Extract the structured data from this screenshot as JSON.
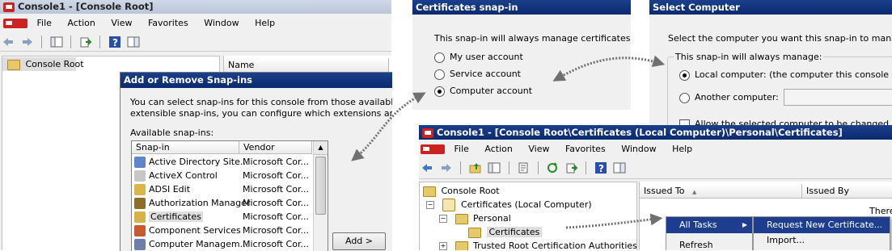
{
  "console1": {
    "title": "Console1 - [Console Root]",
    "menu": [
      "File",
      "Action",
      "View",
      "Favorites",
      "Window",
      "Help"
    ],
    "tree_root": "Console Root",
    "col_name": "Name"
  },
  "add_remove": {
    "title": "Add or Remove Snap-ins",
    "desc_line1": "You can select snap-ins for this console from those available on you",
    "desc_line2": "extensible snap-ins, you can configure which extensions are enable",
    "available_label": "Available snap-ins:",
    "col_snapin": "Snap-in",
    "col_vendor": "Vendor",
    "snapins": [
      {
        "name": "Active Directory Site...",
        "vendor": "Microsoft Cor...",
        "icon": "ad-sites-icon"
      },
      {
        "name": "ActiveX Control",
        "vendor": "Microsoft Cor...",
        "icon": "activex-icon"
      },
      {
        "name": "ADSI Edit",
        "vendor": "Microsoft Cor...",
        "icon": "adsi-edit-icon"
      },
      {
        "name": "Authorization Manager",
        "vendor": "Microsoft Cor...",
        "icon": "authorization-icon"
      },
      {
        "name": "Certificates",
        "vendor": "Microsoft Cor...",
        "icon": "certificates-icon"
      },
      {
        "name": "Component Services",
        "vendor": "Microsoft Cor...",
        "icon": "component-services-icon"
      },
      {
        "name": "Computer Managem...",
        "vendor": "Microsoft Cor...",
        "icon": "computer-management-icon"
      }
    ],
    "add_button": "Add >"
  },
  "cert_snapin": {
    "title": "Certificates snap-in",
    "prompt": "This snap-in will always manage certificates for:",
    "options": [
      "My user account",
      "Service account",
      "Computer account"
    ],
    "selected": 2
  },
  "select_computer": {
    "title": "Select Computer",
    "prompt": "Select the computer you want this snap-in to manage.",
    "group_label": "This snap-in will always manage:",
    "local_option": "Local computer:  (the computer this console is runnin",
    "another_option": "Another computer:",
    "allow_text": "Allow the selected computer to be changed when la"
  },
  "console2": {
    "title": "Console1 - [Console Root\\Certificates (Local Computer)\\Personal\\Certificates]",
    "menu": [
      "File",
      "Action",
      "View",
      "Favorites",
      "Window",
      "Help"
    ],
    "tree": {
      "root": "Console Root",
      "local": "Certificates (Local Computer)",
      "personal": "Personal",
      "certificates": "Certificates",
      "trusted": "Trusted Root Certification Authorities"
    },
    "col_issued_to": "Issued To",
    "col_issued_by": "Issued By",
    "there_text": "There",
    "context_menu": [
      "All Tasks",
      "Refresh"
    ],
    "submenu": [
      "Request New Certificate...",
      "Import..."
    ]
  },
  "colors": {
    "titlebar": "#0b2a70",
    "highlight": "#1e3d8f",
    "arrow": "#707070"
  }
}
